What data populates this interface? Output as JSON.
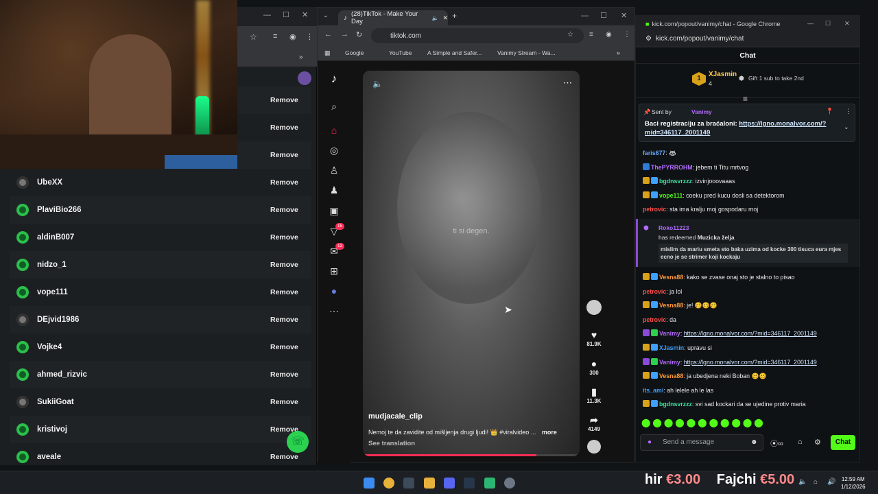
{
  "left_window": {
    "rows": [
      {
        "name": "",
        "action": "Remove"
      },
      {
        "name": "",
        "action": "Remove"
      },
      {
        "name": "",
        "action": "Remove"
      },
      {
        "name": "UbeXX",
        "action": "Remove"
      },
      {
        "name": "PlaviBio266",
        "action": "Remove"
      },
      {
        "name": "aldinB007",
        "action": "Remove"
      },
      {
        "name": "nidzo_1",
        "action": "Remove"
      },
      {
        "name": "vope111",
        "action": "Remove"
      },
      {
        "name": "DEjvid1986",
        "action": "Remove"
      },
      {
        "name": "Vojke4",
        "action": "Remove"
      },
      {
        "name": "ahmed_rizvic",
        "action": "Remove"
      },
      {
        "name": "SukiiGoat",
        "action": "Remove"
      },
      {
        "name": "kristivoj",
        "action": "Remove"
      },
      {
        "name": "aveale",
        "action": "Remove"
      }
    ]
  },
  "tiktok": {
    "tab_title": "(28)TikTok - Make Your Day",
    "url": "tiktok.com",
    "bookmarks": [
      "Google",
      "YouTube",
      "A Simple and Safer...",
      "Vanimy Stream - Wa..."
    ],
    "badges": {
      "inbox": "15",
      "messages": "13"
    },
    "video": {
      "overlay_text": "ti si degen.",
      "author": "mudjacale_clip",
      "description": "Nemoj te da zavidite od mišljenja drugi ljudi! 👑 #viralvideo ...",
      "more": "more",
      "see_translation": "See translation",
      "progress": 0.8
    },
    "actions": {
      "likes": "81.9K",
      "comments": "300",
      "saves": "11.3K",
      "shares": "4149"
    }
  },
  "chat": {
    "window_title": "kick.com/popout/vanimy/chat - Google Chrome",
    "address": "kick.com/popout/vanimy/chat",
    "header": "Chat",
    "top_supporter": {
      "rank": "1",
      "name": "XJasmin",
      "count": "4",
      "gift_text": "Gift 1 sub to take 2nd"
    },
    "pinned": {
      "sent_by": "Sent by",
      "sender": "Vanimy",
      "text": "Baci registraciju za braćaloni:",
      "link": "https://lgno.monalvor.com/?mid=346117_2001149"
    },
    "messages": [
      {
        "user": "faris677",
        "color": "#6aa7ff",
        "text": "🦝"
      },
      {
        "user": "ThePYRROHM",
        "color": "#b26bff",
        "text": "jebem ti Titu mrtvog"
      },
      {
        "user": "bgdnsvrzzz",
        "color": "#3ee0a0",
        "text": "izvinjooovaaas"
      },
      {
        "user": "vope111",
        "color": "#53fc18",
        "text": "coeku pred kucu dosli sa detektorom"
      },
      {
        "user": "petrovic",
        "color": "#ff4b4b",
        "text": "sta ima kralju moj gospodaru moj"
      }
    ],
    "redeem": {
      "user": "Roko11223",
      "action": "has redeemed",
      "reward": "Muzicka želja",
      "note": "mislim da mariu smeta sto baka uzima od kocke 300 tisuca eura mjes ecno je se strimer koji kockaju"
    },
    "messages2": [
      {
        "user": "Vesna88",
        "color": "#ff9a3c",
        "text": "kako se zvase onaj sto je stalno to pisao"
      },
      {
        "user": "petrovic",
        "color": "#ff4b4b",
        "text": "ja lol"
      },
      {
        "user": "Vesna88",
        "color": "#ff9a3c",
        "text": "je! 🥴🥴🥴"
      },
      {
        "user": "petrovic",
        "color": "#ff4b4b",
        "text": "da"
      },
      {
        "user": "Vanimy",
        "color": "#b26bff",
        "text": "https://lgno.monalvor.com/?mid=346117_2001149"
      },
      {
        "user": "XJasmin",
        "color": "#3ea0ff",
        "text": "upravu si"
      },
      {
        "user": "Vanimy",
        "color": "#b26bff",
        "text": "https://lgno.monalvor.com/?mid=346117_2001149"
      },
      {
        "user": "Vesna88",
        "color": "#ff9a3c",
        "text": "ja ubedjena neki Boban 🥴🥴"
      },
      {
        "user": "its_ami",
        "color": "#3ea0ff",
        "text": "ah lelele ah le las"
      },
      {
        "user": "bgdnsvrzzz",
        "color": "#3ee0a0",
        "text": "svi sad kockari da se ujedine protiv maria"
      }
    ],
    "send_placeholder": "Send a message",
    "chat_button": "Chat"
  },
  "taskbar": {
    "time": "12:59 AM",
    "date": "1/12/2026"
  },
  "ticker": {
    "left_word": "hir",
    "left_price": "€3.00",
    "right_word": "Fajchi",
    "right_price": "€5.00"
  }
}
